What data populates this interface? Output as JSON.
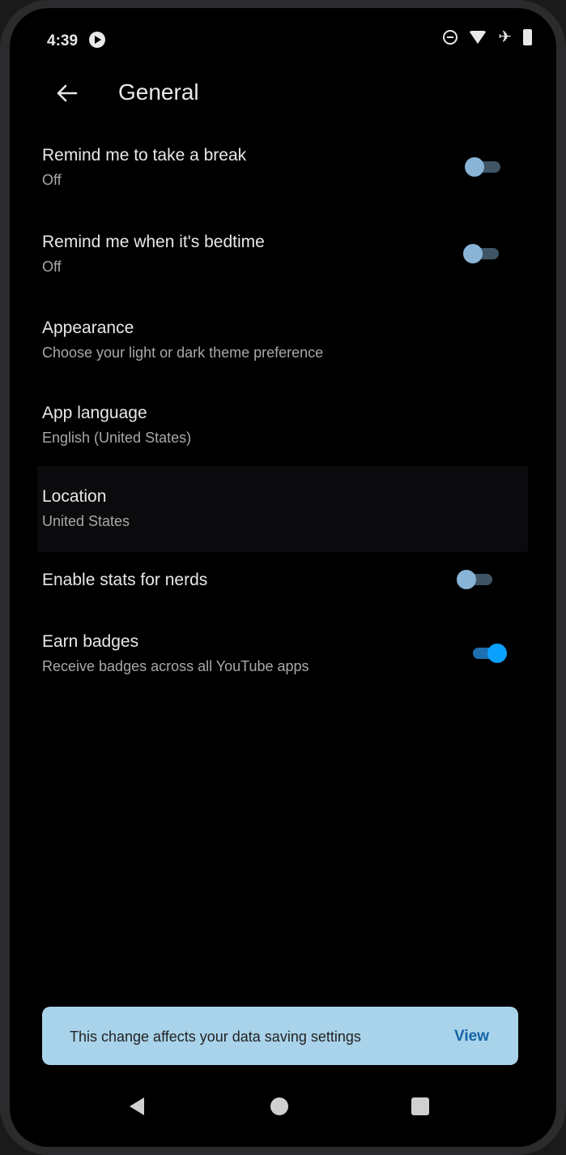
{
  "status_bar": {
    "time": "4:39",
    "icons": [
      "play-icon",
      "do-not-disturb-icon",
      "wifi-icon",
      "airplane-icon",
      "battery-icon"
    ]
  },
  "header": {
    "title": "General",
    "back_icon": "arrow-left-icon"
  },
  "settings": [
    {
      "title": "Remind me to take a break",
      "subtitle": "Off",
      "toggle": false
    },
    {
      "title": "Remind me when it's bedtime",
      "subtitle": "Off",
      "toggle": false
    },
    {
      "title": "Appearance",
      "subtitle": "Choose your light or dark theme preference"
    },
    {
      "title": "App language",
      "subtitle": "English (United States)"
    },
    {
      "title": "Location",
      "subtitle": "United States"
    },
    {
      "title": "Enable stats for nerds",
      "toggle": false
    },
    {
      "title": "Earn badges",
      "subtitle": "Receive badges across all YouTube apps",
      "toggle": true
    }
  ],
  "snackbar": {
    "message": "This change affects your data saving settings",
    "action": "View"
  },
  "nav_bar": {
    "icons": [
      "back-triangle-icon",
      "home-circle-icon",
      "recents-square-icon"
    ]
  },
  "colors": {
    "background": "#000000",
    "toggle_on": "#0aa0ff",
    "toggle_off": "#89b4d6",
    "snackbar_bg": "#a9d3ea",
    "snackbar_action": "#1565a8"
  }
}
